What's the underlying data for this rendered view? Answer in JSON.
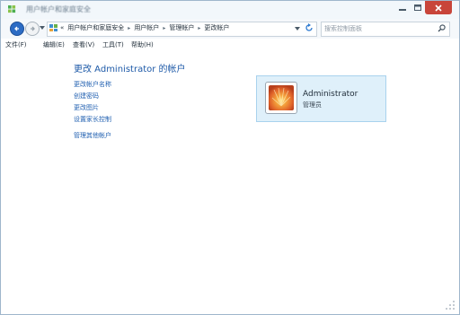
{
  "window": {
    "title": "用户帐户和家庭安全"
  },
  "address_bar": {
    "crumbs": [
      "用户帐户和家庭安全",
      "用户帐户",
      "管理帐户",
      "更改帐户"
    ],
    "overflow_marker": "«"
  },
  "search": {
    "placeholder": "搜索控制面板"
  },
  "menu": {
    "items": [
      "文件(F)",
      "编辑(E)",
      "查看(V)",
      "工具(T)",
      "帮助(H)"
    ]
  },
  "content": {
    "heading": "更改 Administrator 的帐户",
    "tasks": [
      "更改帐户名称",
      "创建密码",
      "更改图片",
      "设置家长控制"
    ],
    "other_link": "管理其他帐户"
  },
  "account": {
    "name": "Administrator",
    "role": "管理员"
  },
  "colors": {
    "link": "#1f5fb0",
    "heading": "#1e5aa8",
    "card_bg": "#dff0fa",
    "close_button": "#c8453a"
  },
  "icons": [
    "control-panel-icon",
    "minimize-icon",
    "maximize-icon",
    "close-icon",
    "back-arrow-icon",
    "forward-arrow-icon",
    "refresh-icon",
    "search-icon",
    "user-picture-icon",
    "resize-grip-icon"
  ]
}
